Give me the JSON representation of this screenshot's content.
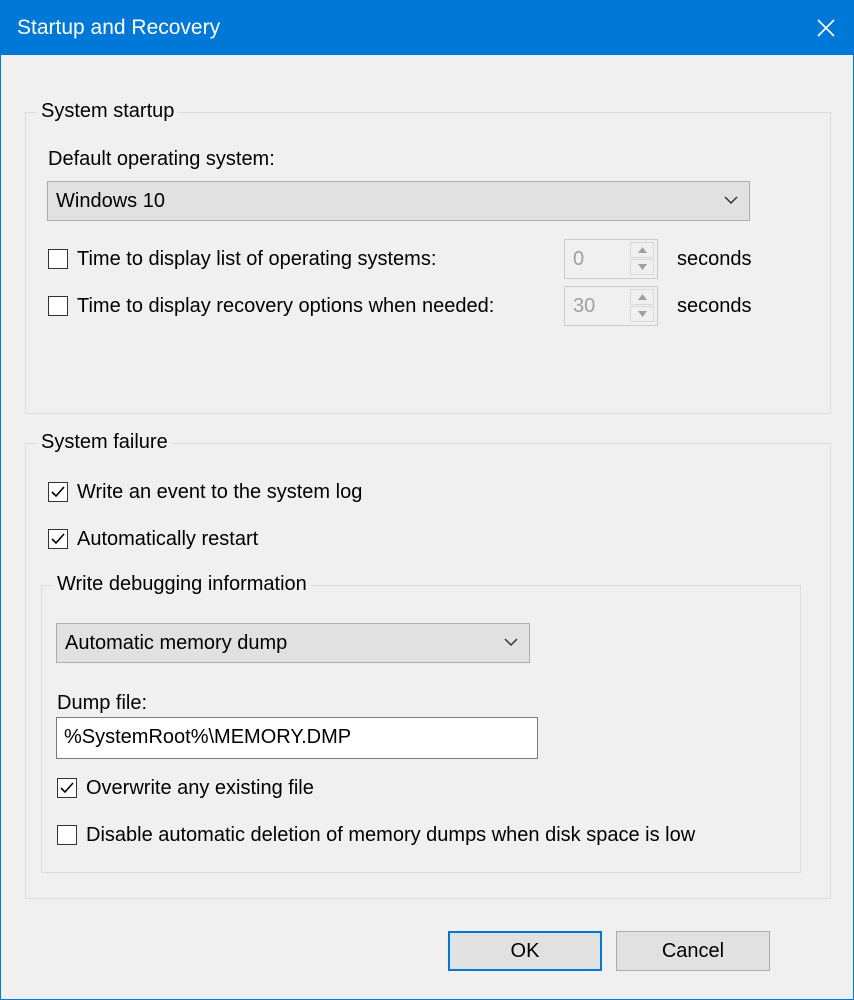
{
  "window": {
    "title": "Startup and Recovery",
    "accent_color": "#0078d7"
  },
  "system_startup": {
    "group_label": "System startup",
    "default_os_label": "Default operating system:",
    "default_os_value": "Windows 10",
    "time_list": {
      "label": "Time to display list of operating systems:",
      "checked": false,
      "value": "0",
      "unit": "seconds"
    },
    "time_recovery": {
      "label": "Time to display recovery options when needed:",
      "checked": false,
      "value": "30",
      "unit": "seconds"
    }
  },
  "system_failure": {
    "group_label": "System failure",
    "write_event": {
      "label": "Write an event to the system log",
      "checked": true
    },
    "auto_restart": {
      "label": "Automatically restart",
      "checked": true
    },
    "debug": {
      "group_label": "Write debugging information",
      "dump_type_value": "Automatic memory dump",
      "dump_file_label": "Dump file:",
      "dump_file_value": "%SystemRoot%\\MEMORY.DMP",
      "overwrite": {
        "label": "Overwrite any existing file",
        "checked": true
      },
      "disable_auto_delete": {
        "label": "Disable automatic deletion of memory dumps when disk space is low",
        "checked": false
      }
    }
  },
  "buttons": {
    "ok": "OK",
    "cancel": "Cancel"
  }
}
